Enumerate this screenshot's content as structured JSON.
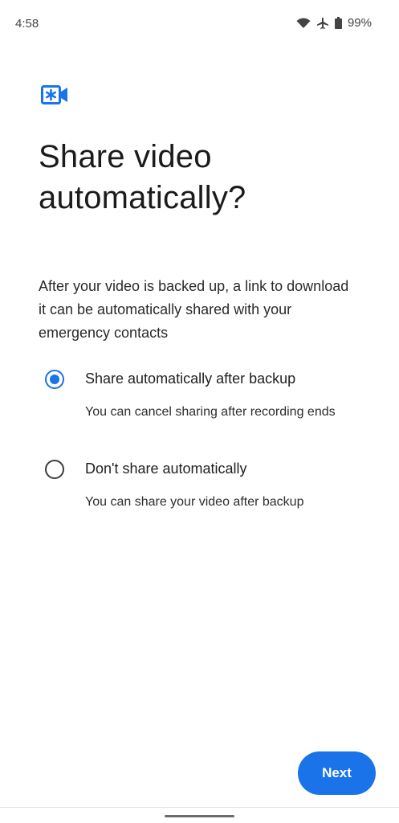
{
  "status_bar": {
    "time": "4:58",
    "battery_percent": "99%",
    "icons": [
      "wifi-icon",
      "airplane-mode-icon",
      "battery-icon"
    ]
  },
  "header": {
    "icon": "video-emergency-icon",
    "title": "Share video automatically?"
  },
  "description": "After your video is backed up, a link to download it can be automatically shared with your emergency contacts",
  "options": [
    {
      "label": "Share automatically after backup",
      "sublabel": "You can cancel sharing after recording ends",
      "selected": true
    },
    {
      "label": "Don't share automatically",
      "sublabel": "You can share your video after backup",
      "selected": false
    }
  ],
  "actions": {
    "next_label": "Next"
  },
  "colors": {
    "accent": "#1a73e8",
    "background": "#ffffff",
    "text": "#1f1f1f"
  }
}
